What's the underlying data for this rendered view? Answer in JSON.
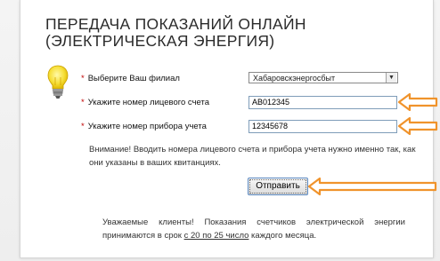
{
  "header": {
    "title_line1": "ПЕРЕДАЧА ПОКАЗАНИЙ ОНЛАЙН",
    "title_line2": "(ЭЛЕКТРИЧЕСКАЯ ЭНЕРГИЯ)"
  },
  "form": {
    "required_mark": "*",
    "branch": {
      "label": "Выберите Ваш филиал",
      "value": "Хабаровскэнергосбыт"
    },
    "account": {
      "label": "Укажите номер лицевого счета",
      "value": "АВ012345"
    },
    "meter": {
      "label": "Укажите номер прибора учета",
      "value": "12345678"
    },
    "notice": "Внимание! Вводить номера лицевого счета и прибора учета нужно именно так, как они указаны в ваших квитанциях.",
    "submit_label": "Отправить"
  },
  "footer": {
    "text_before": "Уважаемые клиенты! Показания счетчиков электрической энергии принимаются в срок ",
    "underlined": "с 20 по 25 число",
    "text_after": " каждого месяца."
  },
  "colors": {
    "arrow": "#f0932b",
    "required": "#c00000"
  },
  "icons": {
    "hint": "lightbulb-icon",
    "dropdown": "chevron-down-icon",
    "pointer": "arrow-left-icon"
  }
}
